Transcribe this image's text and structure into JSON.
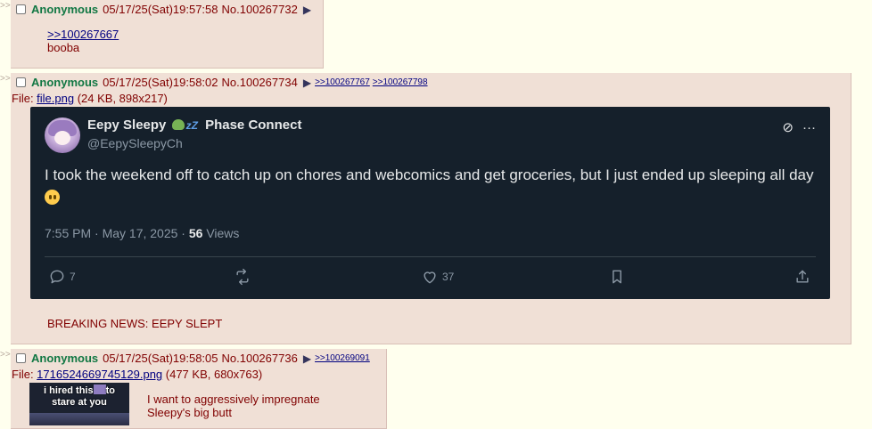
{
  "posts": [
    {
      "name": "Anonymous",
      "date": "05/17/25(Sat)19:57:58",
      "number": "No.100267732",
      "quote": ">>100267667",
      "message": "booba"
    },
    {
      "name": "Anonymous",
      "date": "05/17/25(Sat)19:58:02",
      "number": "No.100267734",
      "backlinks": [
        ">>100267767",
        ">>100267798"
      ],
      "file_label": "File: ",
      "file_name": "file.png",
      "file_meta": " (24 KB, 898x217)",
      "message": "BREAKING NEWS: EEPY SLEPT",
      "tweet": {
        "display_name": "Eepy Sleepy",
        "display_name_suffix": "Phase Connect",
        "handle": "@EepySleepyCh",
        "text": "I took the weekend off to catch up on chores and webcomics and get groceries, but I just ended up sleeping all day",
        "time": "7:55 PM · May 17, 2025 · ",
        "views_count": "56",
        "views_label": " Views",
        "replies": "7",
        "likes": "37",
        "icons": [
          "reply-icon",
          "retweet-icon",
          "like-icon",
          "bookmark-icon",
          "share-icon",
          "grok-icon",
          "more-icon"
        ]
      }
    },
    {
      "name": "Anonymous",
      "date": "05/17/25(Sat)19:58:05",
      "number": "No.100267736",
      "backlinks": [
        ">>100269091"
      ],
      "file_label": "File: ",
      "file_name": "1716524669745129.png",
      "file_meta": " (477 KB, 680x763)",
      "thumb_caption_a": "i hired this",
      "thumb_caption_b": "to",
      "thumb_caption_c": "stare at you",
      "message_lines": [
        "I want to aggressively impregnate",
        "Sleepy's big butt"
      ]
    }
  ],
  "side_marker": ">>",
  "colors": {
    "post_bg": "#f0e0d6",
    "name": "#117743",
    "link": "#000080",
    "tweet_bg": "#15202b"
  }
}
